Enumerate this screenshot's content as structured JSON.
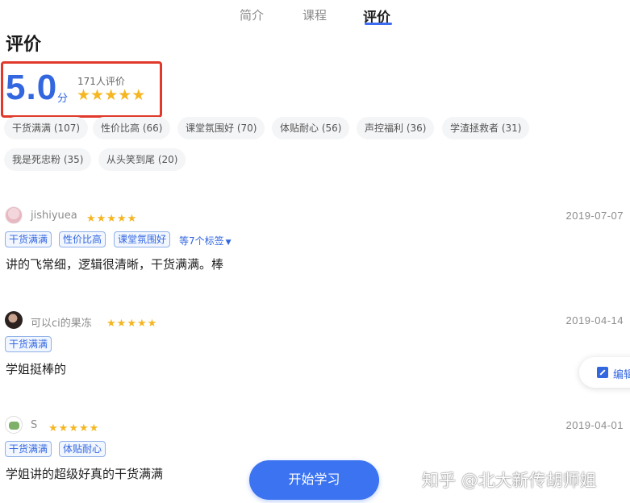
{
  "tabs": [
    {
      "label": "简介"
    },
    {
      "label": "课程"
    },
    {
      "label": "评价"
    }
  ],
  "section_title": "评价",
  "summary": {
    "score": "5.0",
    "unit": "分",
    "count_text": "171人评价",
    "stars": 5
  },
  "tags": [
    {
      "label": "干货满满 (107)"
    },
    {
      "label": "性价比高 (66)"
    },
    {
      "label": "课堂氛围好 (70)"
    },
    {
      "label": "体贴耐心 (56)"
    },
    {
      "label": "声控福利 (36)"
    },
    {
      "label": "学渣拯救者 (31)"
    },
    {
      "label": "我是死忠粉 (35)"
    },
    {
      "label": "从头笑到尾 (20)"
    }
  ],
  "reviews": [
    {
      "username": "jishiyuea",
      "stars": 5,
      "date": "2019-07-07",
      "tags": [
        "干货满满",
        "性价比高",
        "课堂氛围好"
      ],
      "more_tags": "等7个标签",
      "text": "讲的飞常细，逻辑很清晰，干货满满。棒"
    },
    {
      "username": "可以ci的果冻",
      "stars": 5,
      "date": "2019-04-14",
      "tags": [
        "干货满满"
      ],
      "text": "学姐挺棒的"
    },
    {
      "username": "S",
      "stars": 5,
      "date": "2019-04-01",
      "tags": [
        "干货满满",
        "体贴耐心"
      ],
      "text": "学姐讲的超级好真的干货满满"
    }
  ],
  "edit_button": {
    "label": "编辑"
  },
  "start_button": {
    "label": "开始学习"
  },
  "watermark": "知乎 @北大新传胡师姐",
  "colors": {
    "accent": "#3367e0",
    "star": "#f5b622",
    "highlight_box": "#e0392b"
  }
}
